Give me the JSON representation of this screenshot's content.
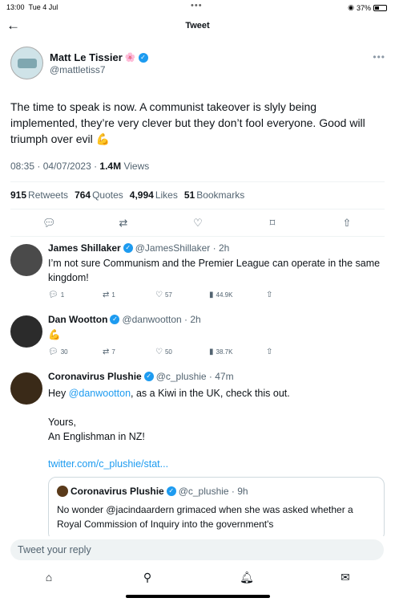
{
  "status": {
    "time": "13:00",
    "date": "Tue 4 Jul",
    "battery": "37%"
  },
  "header": {
    "title": "Tweet"
  },
  "tweet": {
    "author_name": "Matt Le Tissier",
    "author_emoji": "🌸",
    "handle": "@mattletiss7",
    "text": "The time to speak is now. A communist takeover is slyly being implemented, they’re very clever but they don’t fool everyone. Good will triumph over evil 💪",
    "timestamp": "08:35 · 04/07/2023 · ",
    "views_count": "1.4M",
    "views_label": "Views",
    "retweets_count": "915",
    "retweets_label": "Retweets",
    "quotes_count": "764",
    "quotes_label": "Quotes",
    "likes_count": "4,994",
    "likes_label": "Likes",
    "bookmarks_count": "51",
    "bookmarks_label": "Bookmarks"
  },
  "replies": [
    {
      "name": "James Shillaker",
      "handle": "@JamesShillaker · 2h",
      "text": "I’m not sure Communism and the Premier League can operate in the same kingdom!",
      "replies": "1",
      "retweets": "1",
      "likes": "57",
      "views": "44.9K"
    },
    {
      "name": "Dan Wootton",
      "handle": "@danwootton · 2h",
      "text": "💪",
      "replies": "30",
      "retweets": "7",
      "likes": "50",
      "views": "38.7K"
    },
    {
      "name": "Coronavirus Plushie",
      "handle": "@c_plushie · 47m",
      "text_pre": "Hey ",
      "mention": "@danwootton",
      "text_post": ", as a Kiwi in the UK, check this out.",
      "sign1": "Yours,",
      "sign2": "An Englishman in NZ!",
      "link": "twitter.com/c_plushie/stat..."
    }
  ],
  "quote": {
    "name": "Coronavirus Plushie",
    "handle": "@c_plushie · 9h",
    "text": "No wonder @jacindaardern grimaced when she was asked whether a Royal Commission of Inquiry into the government's"
  },
  "compose": {
    "placeholder": "Tweet your reply"
  },
  "colors": {
    "accent": "#1d9bf0",
    "text": "#0f1419",
    "muted": "#536471"
  }
}
